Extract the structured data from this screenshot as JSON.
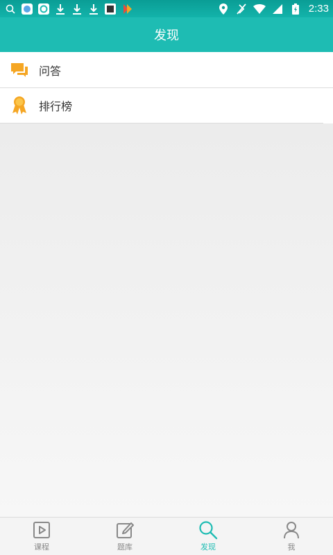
{
  "status_bar": {
    "time": "2:33",
    "icons_left": [
      "search-icon",
      "app-icon",
      "app-icon",
      "download-icon",
      "download-icon",
      "download-icon",
      "app-icon",
      "app-icon"
    ],
    "icons_right": [
      "location-icon",
      "no-signal-icon",
      "wifi-icon",
      "signal-icon",
      "battery-icon"
    ]
  },
  "header": {
    "title": "发现"
  },
  "list": {
    "items": [
      {
        "label": "问答",
        "icon": "chat-bubbles-icon"
      },
      {
        "label": "排行榜",
        "icon": "medal-icon"
      }
    ]
  },
  "tabs": [
    {
      "label": "课程",
      "icon": "play-icon",
      "active": false
    },
    {
      "label": "题库",
      "icon": "edit-icon",
      "active": false
    },
    {
      "label": "发现",
      "icon": "search-icon",
      "active": true
    },
    {
      "label": "我",
      "icon": "user-icon",
      "active": false
    }
  ],
  "colors": {
    "primary": "#1ebcb3",
    "status_bar": "#0a9d95",
    "accent_orange": "#f5a623",
    "background": "#ececec"
  }
}
